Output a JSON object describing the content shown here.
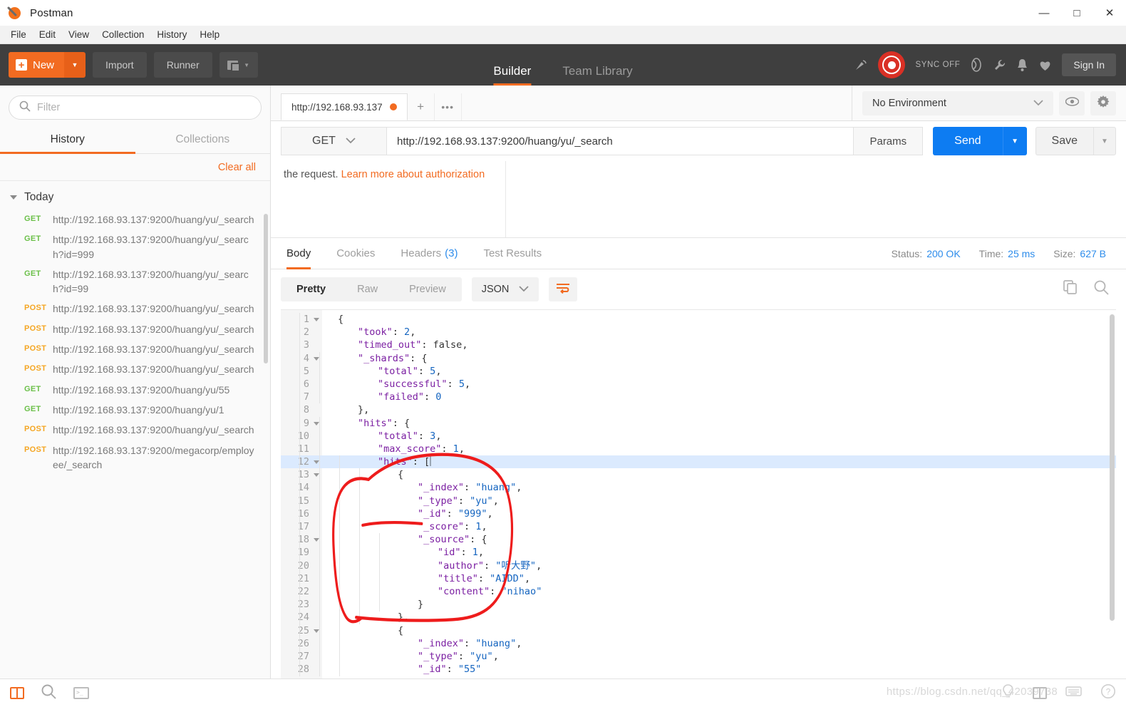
{
  "window": {
    "app_title": "Postman",
    "minimize": "—",
    "maximize": "□",
    "close": "✕"
  },
  "menubar": [
    "File",
    "Edit",
    "View",
    "Collection",
    "History",
    "Help"
  ],
  "toolbar": {
    "new_label": "New",
    "new_plus": "+",
    "import_label": "Import",
    "runner_label": "Runner",
    "center_tabs": [
      {
        "label": "Builder",
        "active": true
      },
      {
        "label": "Team Library",
        "active": false
      }
    ],
    "sync_label": "SYNC OFF",
    "signin_label": "Sign In"
  },
  "sidebar": {
    "filter_placeholder": "Filter",
    "tabs": [
      {
        "label": "History",
        "active": true
      },
      {
        "label": "Collections",
        "active": false
      }
    ],
    "clear_all": "Clear all",
    "group_label": "Today",
    "items": [
      {
        "method": "GET",
        "url": "http://192.168.93.137:9200/huang/yu/_search"
      },
      {
        "method": "GET",
        "url": "http://192.168.93.137:9200/huang/yu/_search?id=999"
      },
      {
        "method": "GET",
        "url": "http://192.168.93.137:9200/huang/yu/_search?id=99"
      },
      {
        "method": "POST",
        "url": "http://192.168.93.137:9200/huang/yu/_search"
      },
      {
        "method": "POST",
        "url": "http://192.168.93.137:9200/huang/yu/_search"
      },
      {
        "method": "POST",
        "url": "http://192.168.93.137:9200/huang/yu/_search"
      },
      {
        "method": "POST",
        "url": "http://192.168.93.137:9200/huang/yu/_search"
      },
      {
        "method": "GET",
        "url": "http://192.168.93.137:9200/huang/yu/55"
      },
      {
        "method": "GET",
        "url": "http://192.168.93.137:9200/huang/yu/1"
      },
      {
        "method": "POST",
        "url": "http://192.168.93.137:9200/huang/yu/_search"
      },
      {
        "method": "POST",
        "url": "http://192.168.93.137:9200/megacorp/employee/_search"
      }
    ]
  },
  "request": {
    "tab_title": "http://192.168.93.137",
    "add_tab": "+",
    "more_tabs": "•••",
    "environment": "No Environment",
    "method": "GET",
    "url": "http://192.168.93.137:9200/huang/yu/_search",
    "params_label": "Params",
    "send_label": "Send",
    "save_label": "Save"
  },
  "auth_note": {
    "text_prefix": "the request. ",
    "link_text": "Learn more about authorization"
  },
  "response": {
    "tabs": [
      {
        "label": "Body",
        "count": "",
        "active": true
      },
      {
        "label": "Cookies",
        "count": "",
        "active": false
      },
      {
        "label": "Headers",
        "count": "(3)",
        "active": false
      },
      {
        "label": "Test Results",
        "count": "",
        "active": false
      }
    ],
    "status_label": "Status:",
    "status_value": "200 OK",
    "time_label": "Time:",
    "time_value": "25 ms",
    "size_label": "Size:",
    "size_value": "627 B",
    "view_modes": [
      {
        "label": "Pretty",
        "active": true
      },
      {
        "label": "Raw",
        "active": false
      },
      {
        "label": "Preview",
        "active": false
      }
    ],
    "format": "JSON",
    "body_lines": [
      {
        "n": 1,
        "fold": true,
        "indent": 0,
        "text": "{"
      },
      {
        "n": 2,
        "fold": false,
        "indent": 1,
        "text": "\"took\": 2,"
      },
      {
        "n": 3,
        "fold": false,
        "indent": 1,
        "text": "\"timed_out\": false,"
      },
      {
        "n": 4,
        "fold": true,
        "indent": 1,
        "text": "\"_shards\": {"
      },
      {
        "n": 5,
        "fold": false,
        "indent": 2,
        "text": "\"total\": 5,"
      },
      {
        "n": 6,
        "fold": false,
        "indent": 2,
        "text": "\"successful\": 5,"
      },
      {
        "n": 7,
        "fold": false,
        "indent": 2,
        "text": "\"failed\": 0"
      },
      {
        "n": 8,
        "fold": false,
        "indent": 1,
        "text": "},"
      },
      {
        "n": 9,
        "fold": true,
        "indent": 1,
        "text": "\"hits\": {"
      },
      {
        "n": 10,
        "fold": false,
        "indent": 2,
        "text": "\"total\": 3,"
      },
      {
        "n": 11,
        "fold": false,
        "indent": 2,
        "text": "\"max_score\": 1,"
      },
      {
        "n": 12,
        "fold": true,
        "indent": 2,
        "text": "\"hits\": [",
        "highlight": true
      },
      {
        "n": 13,
        "fold": true,
        "indent": 3,
        "text": "{"
      },
      {
        "n": 14,
        "fold": false,
        "indent": 4,
        "text": "\"_index\": \"huang\","
      },
      {
        "n": 15,
        "fold": false,
        "indent": 4,
        "text": "\"_type\": \"yu\","
      },
      {
        "n": 16,
        "fold": false,
        "indent": 4,
        "text": "\"_id\": \"999\","
      },
      {
        "n": 17,
        "fold": false,
        "indent": 4,
        "text": "\"_score\": 1,"
      },
      {
        "n": 18,
        "fold": true,
        "indent": 4,
        "text": "\"_source\": {"
      },
      {
        "n": 19,
        "fold": false,
        "indent": 5,
        "text": "\"id\": 1,"
      },
      {
        "n": 20,
        "fold": false,
        "indent": 5,
        "text": "\"author\": \"听大野\","
      },
      {
        "n": 21,
        "fold": false,
        "indent": 5,
        "text": "\"title\": \"AIDD\","
      },
      {
        "n": 22,
        "fold": false,
        "indent": 5,
        "text": "\"content\": \"nihao\""
      },
      {
        "n": 23,
        "fold": false,
        "indent": 4,
        "text": "}"
      },
      {
        "n": 24,
        "fold": false,
        "indent": 3,
        "text": "},"
      },
      {
        "n": 25,
        "fold": true,
        "indent": 3,
        "text": "{"
      },
      {
        "n": 26,
        "fold": false,
        "indent": 4,
        "text": "\"_index\": \"huang\","
      },
      {
        "n": 27,
        "fold": false,
        "indent": 4,
        "text": "\"_type\": \"yu\","
      },
      {
        "n": 28,
        "fold": false,
        "indent": 4,
        "text": "\"_id\": \"55\""
      }
    ]
  },
  "annotation": {
    "color": "#ee1c1c",
    "shape": "hand-drawn-circle-around-first-hit",
    "underline": "under _id 999"
  },
  "bottombar": {
    "watermark": "https://blog.csdn.net/qq_42039738"
  },
  "colors": {
    "accent_orange": "#f26b21",
    "send_blue": "#0d7cf2",
    "get_green": "#6cc04a",
    "post_orange": "#f5a623",
    "link_blue": "#2d8ceb",
    "annotation_red": "#ee1c1c",
    "dark_toolbar": "#3f3f3f"
  }
}
